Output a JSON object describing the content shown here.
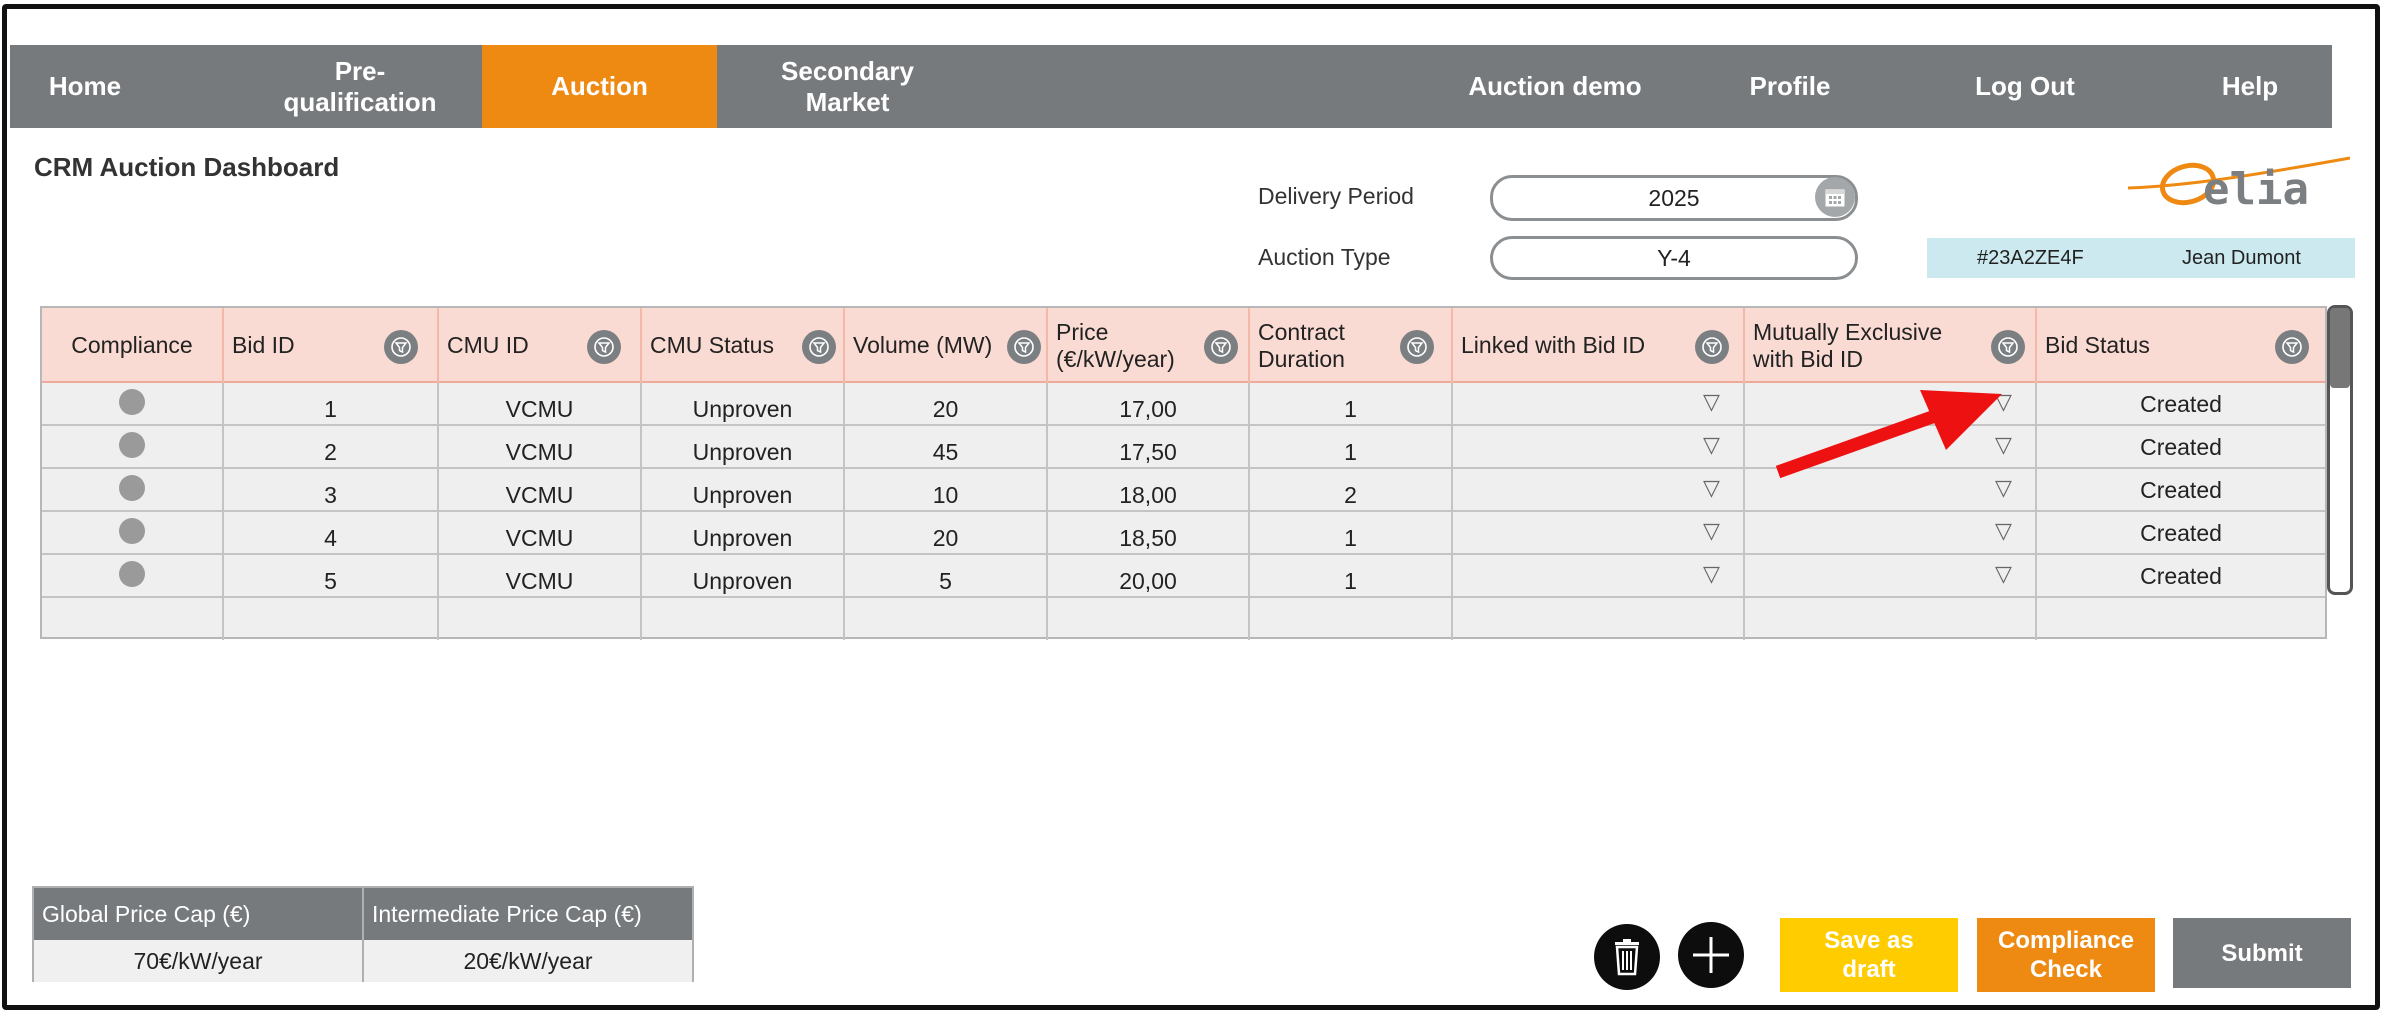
{
  "nav": {
    "items": [
      {
        "label": "Home"
      },
      {
        "label": "Pre-\nqualification"
      },
      {
        "label": "Auction"
      },
      {
        "label": "Secondary\nMarket"
      },
      {
        "label": "Auction demo"
      },
      {
        "label": "Profile"
      },
      {
        "label": "Log Out"
      },
      {
        "label": "Help"
      }
    ],
    "active_index": 2
  },
  "page_title": "CRM Auction Dashboard",
  "filters": {
    "delivery_period_label": "Delivery Period",
    "delivery_period_value": "2025",
    "auction_type_label": "Auction Type",
    "auction_type_value": "Y-4"
  },
  "brand": {
    "logo_text": "elia"
  },
  "user": {
    "id": "#23A2ZE4F",
    "name": "Jean Dumont"
  },
  "table": {
    "columns": [
      {
        "label": "Compliance"
      },
      {
        "label": "Bid ID"
      },
      {
        "label": "CMU ID"
      },
      {
        "label": "CMU Status"
      },
      {
        "label": "Volume (MW)"
      },
      {
        "label": "Price\n(€/kW/year)"
      },
      {
        "label": "Contract\nDuration"
      },
      {
        "label": "Linked with Bid ID"
      },
      {
        "label": "Mutually Exclusive\nwith Bid ID"
      },
      {
        "label": "Bid Status"
      }
    ],
    "rows": [
      {
        "bid_id": "1",
        "cmu_id": "VCMU",
        "cmu_status": "Unproven",
        "volume": "20",
        "price": "17,00",
        "duration": "1",
        "status": "Created"
      },
      {
        "bid_id": "2",
        "cmu_id": "VCMU",
        "cmu_status": "Unproven",
        "volume": "45",
        "price": "17,50",
        "duration": "1",
        "status": "Created"
      },
      {
        "bid_id": "3",
        "cmu_id": "VCMU",
        "cmu_status": "Unproven",
        "volume": "10",
        "price": "18,00",
        "duration": "2",
        "status": "Created"
      },
      {
        "bid_id": "4",
        "cmu_id": "VCMU",
        "cmu_status": "Unproven",
        "volume": "20",
        "price": "18,50",
        "duration": "1",
        "status": "Created"
      },
      {
        "bid_id": "5",
        "cmu_id": "VCMU",
        "cmu_status": "Unproven",
        "volume": "5",
        "price": "20,00",
        "duration": "1",
        "status": "Created"
      }
    ]
  },
  "caps": {
    "global_label": "Global Price Cap (€)",
    "global_value": "70€/kW/year",
    "intermediate_label": "Intermediate Price Cap (€)",
    "intermediate_value": "20€/kW/year"
  },
  "actions": {
    "save_draft": "Save as\ndraft",
    "compliance_check": "Compliance\nCheck",
    "submit": "Submit"
  },
  "colors": {
    "nav_bg": "#767a7d",
    "accent": "#ee8a12",
    "save_btn": "#ffcc00",
    "submit_btn": "#767a7d",
    "header_bg": "#fadbd3",
    "arrow": "#ee1111"
  },
  "icons": [
    "calendar-icon",
    "filter-icon",
    "dropdown-triangle-icon",
    "trash-icon",
    "plus-icon",
    "arrow-annotation"
  ]
}
